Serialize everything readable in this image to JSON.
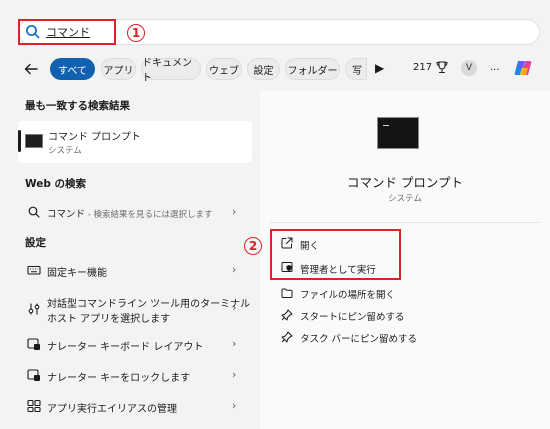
{
  "search": {
    "query": "コマンド",
    "badge_number": "①"
  },
  "filters": {
    "chips": [
      "すべて",
      "アプリ",
      "ドキュメント",
      "ウェブ",
      "設定",
      "フォルダー",
      "写"
    ],
    "count": "217",
    "avatar_letter": "V",
    "more_label": "..."
  },
  "left": {
    "best_match_heading": "最も一致する検索結果",
    "best_match": {
      "title": "コマンド プロンプト",
      "subtitle": "システム"
    },
    "web_heading": "Web の検索",
    "web_item": {
      "query": "コマンド",
      "suffix": " - 検索結果を見るには選択します"
    },
    "settings_heading": "設定",
    "settings_items": [
      {
        "label": "固定キー機能"
      },
      {
        "label_line1": "対話型コマンドライン ツール用のターミナル",
        "label_line2": "ホスト アプリを選択します"
      },
      {
        "label": "ナレーター キーボード レイアウト"
      },
      {
        "label": "ナレーター キーをロックします"
      },
      {
        "label": "アプリ実行エイリアスの管理"
      }
    ]
  },
  "right": {
    "app_title": "コマンド プロンプト",
    "app_subtitle": "システム",
    "badge_number": "②",
    "actions": [
      "開く",
      "管理者として実行",
      "ファイルの場所を開く",
      "スタートにピン留めする",
      "タスク バーにピン留めする"
    ]
  },
  "colors": {
    "accent": "#1062b0",
    "annotation_red": "#d8232a"
  }
}
